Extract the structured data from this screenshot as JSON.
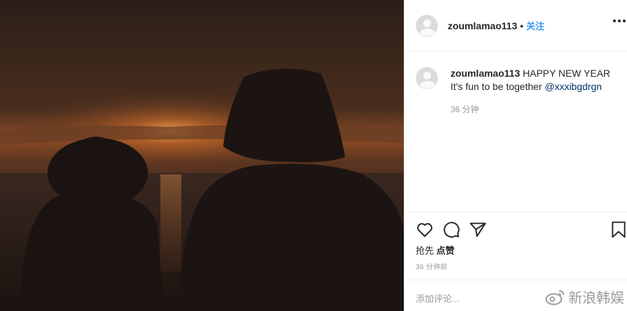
{
  "post": {
    "username": "zoumlamao113",
    "separator": "•",
    "follow_label": "关注",
    "caption_user": "zoumlamao113",
    "caption_text": " HAPPY NEW YEAR It's fun to be together ",
    "caption_mention": "@xxxibgdrgn",
    "comment_time": "36 分钟",
    "likes_prefix": "抢先 ",
    "likes_label": "点赞",
    "post_time": "36 分钟前",
    "add_comment_placeholder": "添加评论..."
  },
  "watermark": {
    "text": "新浪韩娱"
  },
  "icons": [
    "heart-icon",
    "comment-icon",
    "share-icon",
    "bookmark-icon",
    "more-icon",
    "weibo-icon"
  ],
  "colors": {
    "link": "#3897f0",
    "mention": "#003569",
    "secondary_text": "#999999"
  }
}
